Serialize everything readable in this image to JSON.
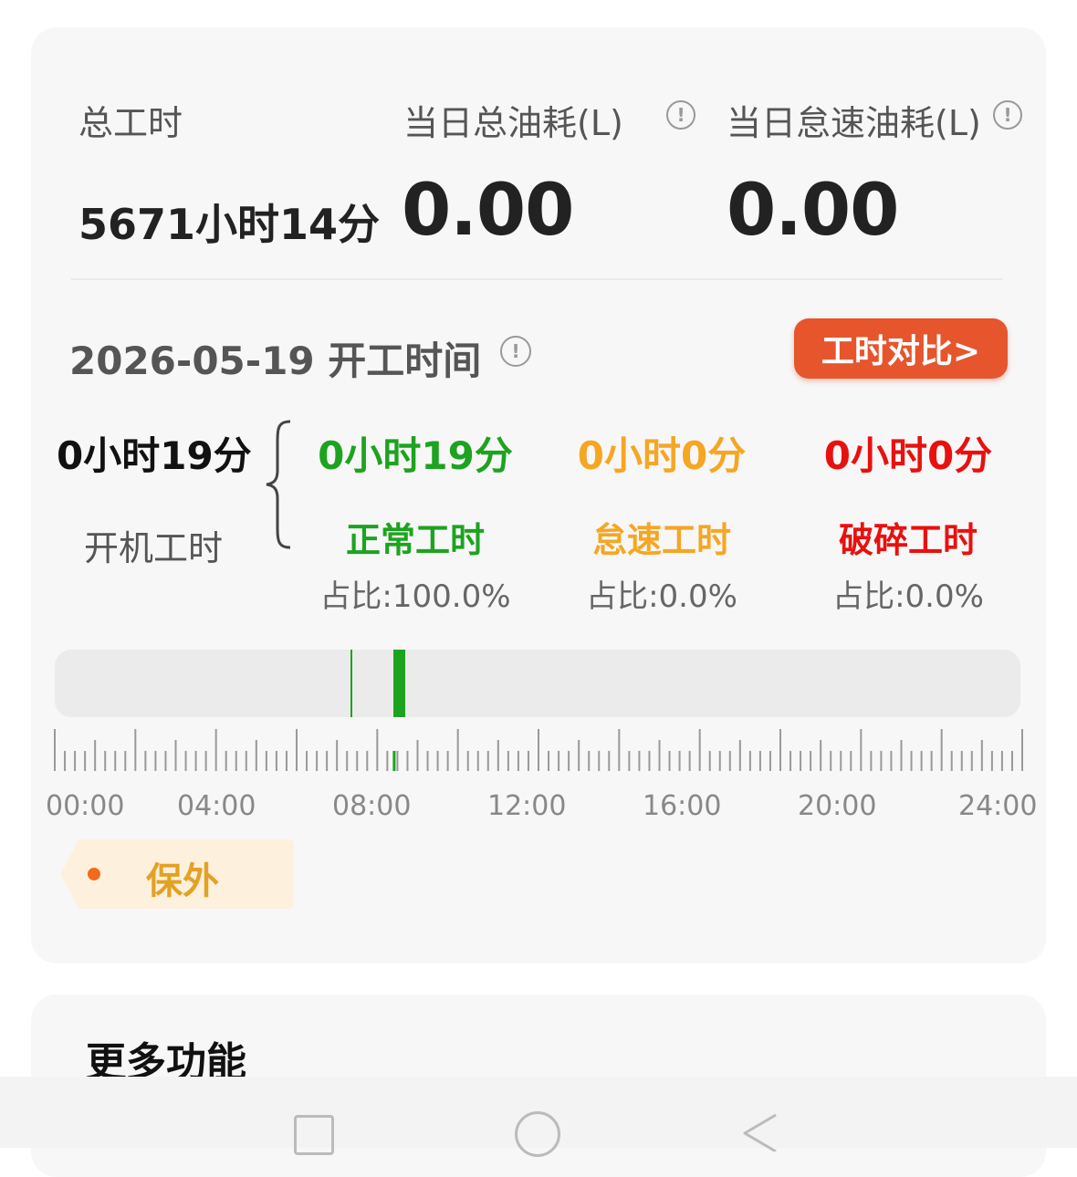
{
  "summary": {
    "total_hours_label": "总工时",
    "total_hours_value": "5671小时14分",
    "daily_fuel_label": "当日总油耗(L)",
    "daily_fuel_value": "0.00",
    "idle_fuel_label": "当日怠速油耗(L)",
    "idle_fuel_value": "0.00"
  },
  "worktime": {
    "date": "2026-05-19",
    "title": "开工时间",
    "compare_button": "工时对比>",
    "on_hours_value": "0小时19分",
    "on_hours_label": "开机工时",
    "categories": [
      {
        "value": "0小时19分",
        "name": "正常工时",
        "percent": "占比:100.0%",
        "color": "#1da31f"
      },
      {
        "value": "0小时0分",
        "name": "怠速工时",
        "percent": "占比:0.0%",
        "color": "#f5a623"
      },
      {
        "value": "0小时0分",
        "name": "破碎工时",
        "percent": "占比:0.0%",
        "color": "#e8110f"
      }
    ]
  },
  "timeline": {
    "axis_labels": [
      "00:00",
      "04:00",
      "08:00",
      "12:00",
      "16:00",
      "20:00",
      "24:00"
    ],
    "active_segments": [
      {
        "start_hour": 7.35,
        "end_hour": 7.39
      },
      {
        "start_hour": 8.42,
        "end_hour": 8.72
      }
    ],
    "active_color": "#1da31f"
  },
  "warranty_tag": {
    "label": "保外"
  },
  "more_section": {
    "title": "更多功能"
  }
}
